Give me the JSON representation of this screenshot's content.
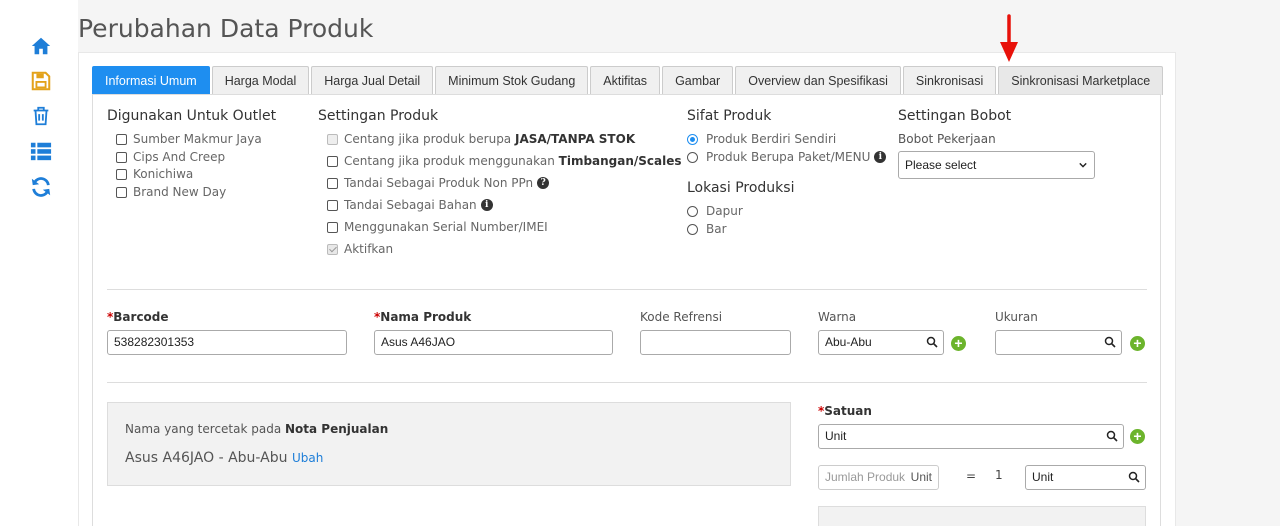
{
  "page": {
    "title": "Perubahan Data Produk"
  },
  "sidebar": {
    "icons": [
      "home-icon",
      "save-icon",
      "trash-icon",
      "list-icon",
      "refresh-icon"
    ]
  },
  "tabs": [
    {
      "label": "Informasi Umum"
    },
    {
      "label": "Harga Modal"
    },
    {
      "label": "Harga Jual Detail"
    },
    {
      "label": "Minimum Stok Gudang"
    },
    {
      "label": "Aktifitas"
    },
    {
      "label": "Gambar"
    },
    {
      "label": "Overview dan Spesifikasi"
    },
    {
      "label": "Sinkronisasi"
    },
    {
      "label": "Sinkronisasi Marketplace"
    }
  ],
  "outlet": {
    "heading": "Digunakan Untuk Outlet",
    "items": [
      "Sumber Makmur Jaya",
      "Cips And Creep",
      "Konichiwa",
      "Brand New Day"
    ]
  },
  "settings": {
    "heading": "Settingan Produk",
    "jasa_prefix": "Centang jika produk berupa ",
    "jasa_bold": "JASA/TANPA STOK",
    "scale_prefix": "Centang jika produk menggunakan ",
    "scale_bold": "Timbangan/Scales",
    "non_ppn": "Tandai Sebagai Produk Non PPn",
    "bahan": "Tandai Sebagai Bahan",
    "serial": "Menggunakan Serial Number/IMEI",
    "aktifkan": "Aktifkan"
  },
  "sifat": {
    "heading": "Sifat Produk",
    "options": [
      "Produk Berdiri Sendiri",
      "Produk Berupa Paket/MENU"
    ]
  },
  "lokasi": {
    "heading": "Lokasi Produksi",
    "options": [
      "Dapur",
      "Bar"
    ]
  },
  "bobot": {
    "heading": "Settingan Bobot",
    "label": "Bobot Pekerjaan",
    "selected": "Please select"
  },
  "fields": {
    "barcode_label": "Barcode",
    "barcode_value": "538282301353",
    "nama_label": "Nama Produk",
    "nama_value": "Asus A46JAO",
    "kode_label": "Kode Refrensi",
    "kode_value": "",
    "warna_label": "Warna",
    "warna_value": "Abu-Abu",
    "ukuran_label": "Ukuran",
    "ukuran_value": ""
  },
  "nota": {
    "prefix": "Nama yang tercetak pada ",
    "bold": "Nota Penjualan",
    "value": "Asus A46JAO - Abu-Abu",
    "link": "Ubah"
  },
  "satuan": {
    "label": "Satuan",
    "value": "Unit",
    "jumlah_placeholder": "Jumlah Produk",
    "jumlah_unit": "Unit",
    "equals": "=",
    "one": "1",
    "target_unit": "Unit"
  },
  "colors": {
    "accent": "#1e8ef0",
    "icon": "#1e7ed8",
    "add": "#6cb42c",
    "arrow": "#e8110a"
  }
}
